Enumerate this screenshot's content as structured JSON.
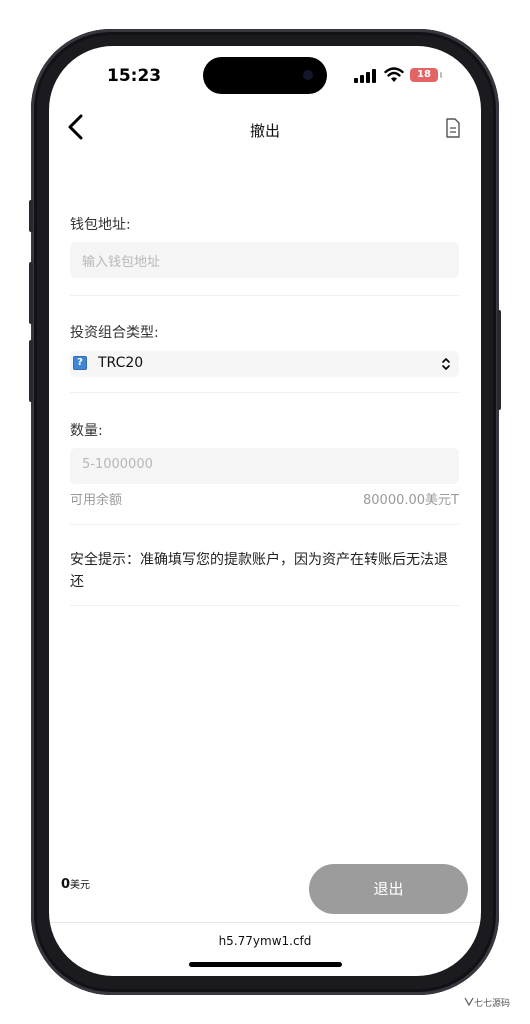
{
  "status_bar": {
    "time": "15:23",
    "battery": "18"
  },
  "nav": {
    "title": "撤出"
  },
  "form": {
    "wallet_label": "钱包地址:",
    "wallet_placeholder": "输入钱包地址",
    "portfolio_label": "投资组合类型:",
    "portfolio_value": "TRC20",
    "portfolio_icon": "?",
    "quantity_label": "数量:",
    "quantity_placeholder": "5-1000000",
    "available_label": "可用余额",
    "available_value": "80000.00美元T"
  },
  "notice": {
    "text": "安全提示：准确填写您的提款账户，因为资产在转账后无法退还"
  },
  "footer": {
    "amount": "0",
    "amount_unit": "美元",
    "withdraw_label": "退出"
  },
  "browser": {
    "url": "h5.77ymw1.cfd"
  },
  "watermark": {
    "text": "七七源码"
  },
  "colors": {
    "button_bg": "#9c9c9c",
    "input_bg": "#f5f5f5",
    "battery": "#e26464"
  }
}
